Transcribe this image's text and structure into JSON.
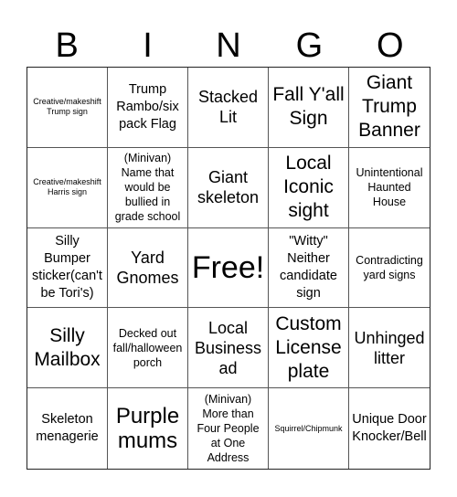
{
  "header": {
    "letters": [
      "B",
      "I",
      "N",
      "G",
      "O"
    ]
  },
  "grid": {
    "cells": [
      {
        "text": "Creative/makeshift Trump sign",
        "size": "s-xs"
      },
      {
        "text": "Trump Rambo/six pack Flag",
        "size": "s-md"
      },
      {
        "text": "Stacked Lit",
        "size": "s-lg"
      },
      {
        "text": "Fall Y'all Sign",
        "size": "s-xl"
      },
      {
        "text": "Giant Trump Banner",
        "size": "s-xl"
      },
      {
        "text": "Creative/makeshift Harris sign",
        "size": "s-xs"
      },
      {
        "text": "(Minivan) Name that would be bullied in grade school",
        "size": "s-sm"
      },
      {
        "text": "Giant skeleton",
        "size": "s-lg"
      },
      {
        "text": "Local Iconic sight",
        "size": "s-xl"
      },
      {
        "text": "Unintentional Haunted House",
        "size": "s-sm"
      },
      {
        "text": "Silly Bumper sticker(can't be Tori's)",
        "size": "s-md"
      },
      {
        "text": "Yard Gnomes",
        "size": "s-lg"
      },
      {
        "text": "Free!",
        "size": "s-free"
      },
      {
        "text": "\"Witty\" Neither candidate sign",
        "size": "s-md"
      },
      {
        "text": "Contradicting yard signs",
        "size": "s-sm"
      },
      {
        "text": "Silly Mailbox",
        "size": "s-xl"
      },
      {
        "text": "Decked out fall/halloween porch",
        "size": "s-sm"
      },
      {
        "text": "Local Business ad",
        "size": "s-lg"
      },
      {
        "text": "Custom License plate",
        "size": "s-xl"
      },
      {
        "text": "Unhinged litter",
        "size": "s-lg"
      },
      {
        "text": "Skeleton menagerie",
        "size": "s-md"
      },
      {
        "text": "Purple mums",
        "size": "s-xxl"
      },
      {
        "text": "(Minivan) More than Four People at One Address",
        "size": "s-sm"
      },
      {
        "text": "Squirrel/Chipmunk",
        "size": "s-xs"
      },
      {
        "text": "Unique Door Knocker/Bell",
        "size": "s-md"
      }
    ]
  }
}
